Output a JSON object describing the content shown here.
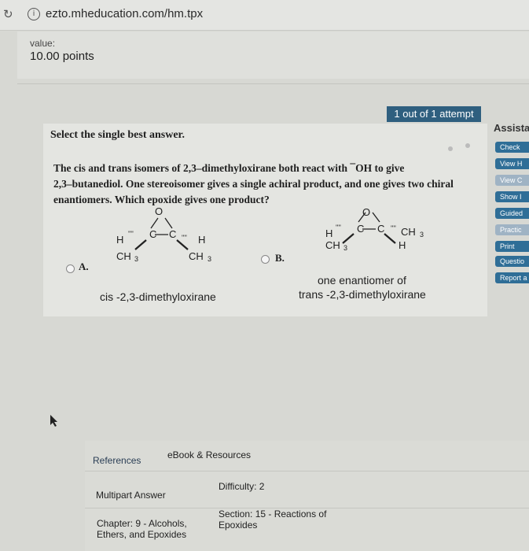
{
  "browser": {
    "url": "ezto.mheducation.com/hm.tpx",
    "reload_icon": "reload-icon",
    "info_icon": "info-icon"
  },
  "value": {
    "label": "value:",
    "points": "10.00 points"
  },
  "attempts": "1 out of 1 attempt",
  "assistance": {
    "title": "Assista",
    "buttons": [
      "Check",
      "View H",
      "View C",
      "Show I",
      "Guided",
      "Practic",
      "Print",
      "Questio",
      "Report a"
    ]
  },
  "question": {
    "header": "Select the single best answer.",
    "lines": [
      "The cis and trans isomers of 2,3–dimethyloxirane both react with ¯OH to give",
      "2,3–butanediol. One stereoisomer gives a single achiral product, and one gives two chiral",
      "enantiomers. Which epoxide gives one product?"
    ],
    "options": [
      {
        "letter": "A.",
        "atoms": {
          "o": "O",
          "c1": "C",
          "c2": "C",
          "h_left": "H",
          "h_right": "H",
          "sub_left": "CH",
          "sub_right": "CH",
          "sub3": "3"
        },
        "name": "cis -2,3-dimethyloxirane",
        "extra": ""
      },
      {
        "letter": "B.",
        "atoms": {
          "o": "O",
          "c1": "C",
          "c2": "C",
          "h_left": "H",
          "h_right": "H",
          "sub_left": "CH",
          "sub_right": "CH",
          "sub3": "3"
        },
        "name": "trans -2,3-dimethyloxirane",
        "extra": "one enantiomer of"
      }
    ]
  },
  "bottom": {
    "tabs": [
      "References",
      "eBook & Resources"
    ],
    "rows": [
      {
        "left": "Multipart Answer",
        "right": "Difficulty: 2"
      },
      {
        "left": "Chapter: 9 - Alcohols,\nEthers, and Epoxides",
        "right": "Section: 15 - Reactions of\nEpoxides"
      }
    ]
  }
}
